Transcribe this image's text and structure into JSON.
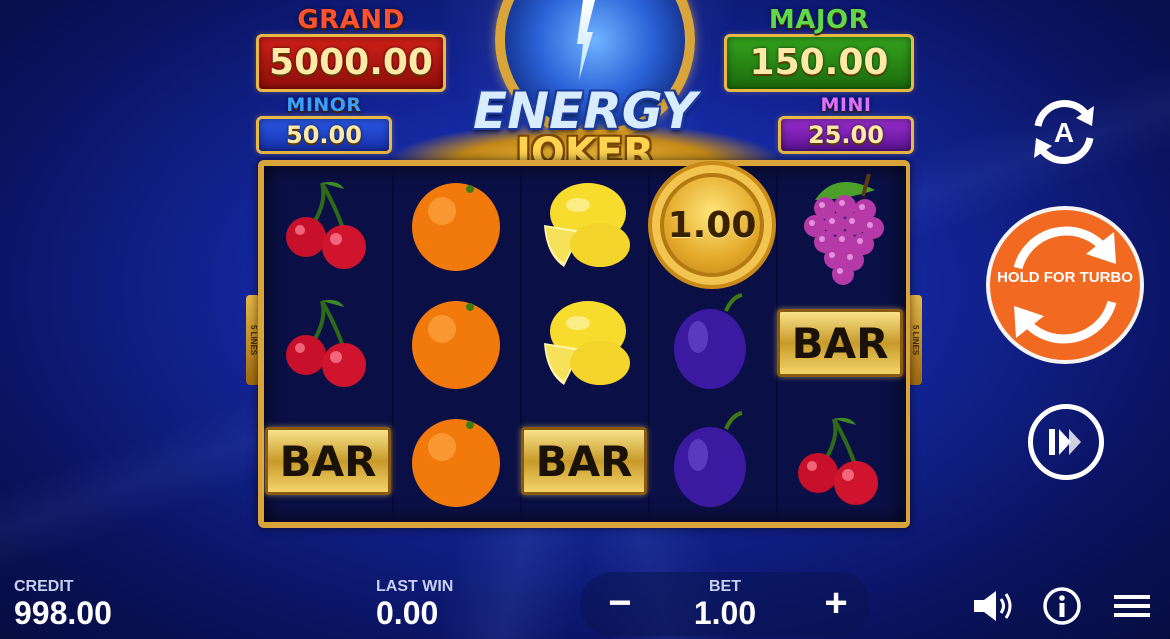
{
  "jackpots": {
    "grand": {
      "label": "GRAND",
      "value": "5000.00"
    },
    "major": {
      "label": "MAJOR",
      "value": "150.00"
    },
    "minor": {
      "label": "MINOR",
      "value": "50.00"
    },
    "mini": {
      "label": "MINI",
      "value": "25.00"
    }
  },
  "logo": {
    "line1": "ENERGY",
    "line2": "JOKER"
  },
  "paylines": {
    "label": "5 LINES"
  },
  "reels": [
    [
      "cherry",
      "cherry",
      "bar"
    ],
    [
      "orange",
      "orange",
      "orange"
    ],
    [
      "lemon",
      "lemon",
      "bar"
    ],
    [
      "coin",
      "plum",
      "plum"
    ],
    [
      "grapes",
      "bar",
      "cherry"
    ]
  ],
  "symbols": {
    "bar_label": "BAR",
    "coin_value": "1.00"
  },
  "controls": {
    "autoplay_icon": "autoplay-A-icon",
    "spin_label": "HOLD FOR TURBO",
    "turbo_icon": "fast-forward-icon"
  },
  "footer": {
    "credit_label": "CREDIT",
    "credit_value": "998.00",
    "lastwin_label": "LAST WIN",
    "lastwin_value": "0.00",
    "bet_label": "BET",
    "bet_value": "1.00",
    "minus": "−",
    "plus": "+",
    "sound_icon": "speaker-icon",
    "info_icon": "info-icon",
    "menu_icon": "hamburger-menu-icon"
  },
  "colors": {
    "spin": "#f26a22",
    "frame_gold": "#d9a43a",
    "background": "#13269a"
  }
}
